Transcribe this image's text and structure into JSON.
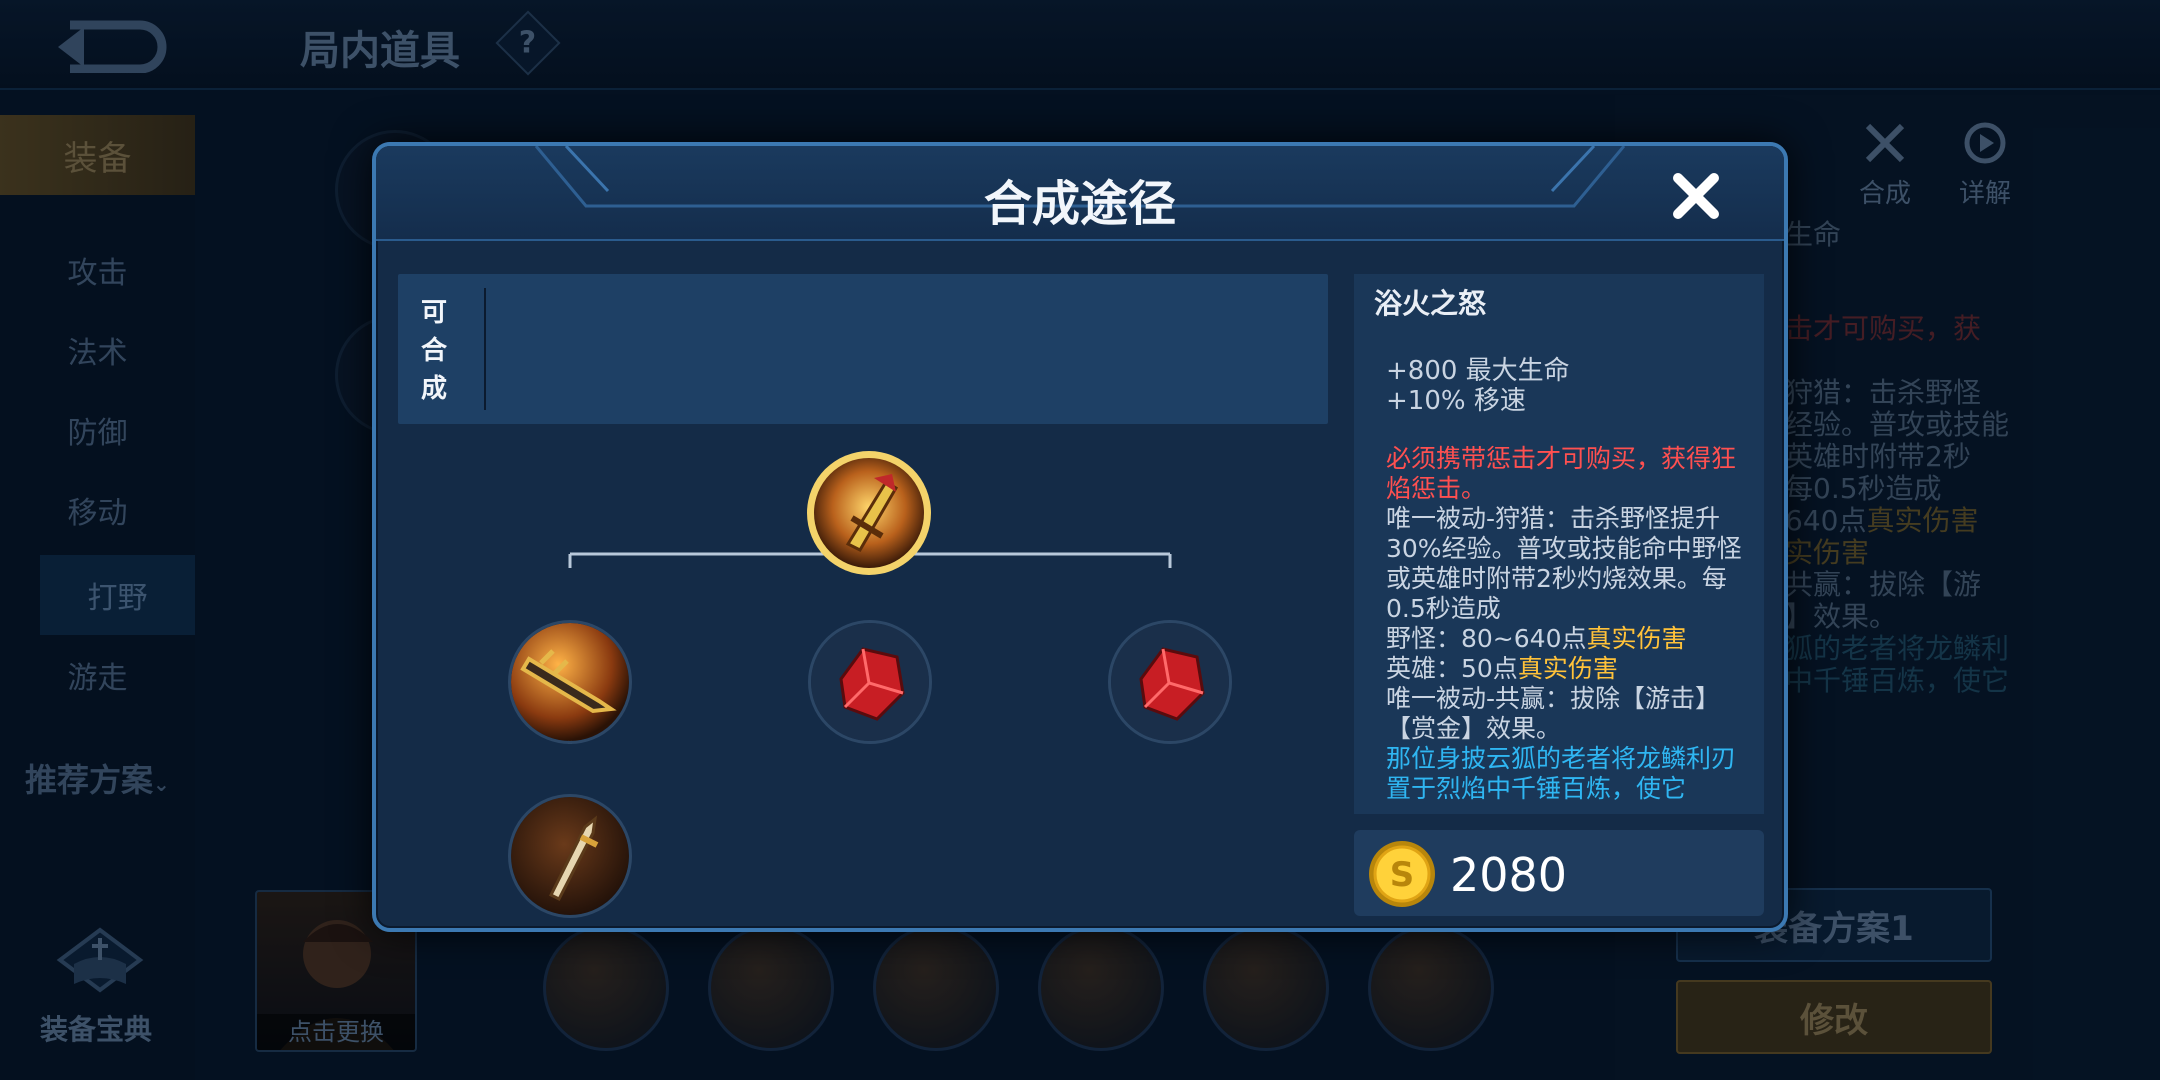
{
  "header": {
    "title": "局内道具",
    "help": "?"
  },
  "sidebar": {
    "items": [
      {
        "label": "装备"
      },
      {
        "label": "攻击"
      },
      {
        "label": "法术"
      },
      {
        "label": "防御"
      },
      {
        "label": "移动"
      },
      {
        "label": "打野"
      },
      {
        "label": "游走"
      }
    ],
    "recommend": "推荐方案",
    "codex": "装备宝典"
  },
  "hero": {
    "change_label": "点击更换"
  },
  "right_panel": {
    "blend": "合成",
    "detail": "详解",
    "plan_button": "装备方案1",
    "modify_button": "修改"
  },
  "modal": {
    "title": "合成途径",
    "craftable_label": "可合成",
    "item": {
      "name": "浴火之怒",
      "stats": [
        "+800 最大生命",
        "+10% 移速"
      ],
      "description": {
        "requirement": "必须携带惩击才可购买，获得狂焰惩击。",
        "passive1_a": "唯一被动-狩猎：击杀野怪提升30%经验。普攻或技能命中野怪或英雄时附带2秒灼烧效果。每0.5秒造成",
        "monster_prefix": "野怪：80~640点",
        "true_damage": "真实伤害",
        "hero_prefix": "英雄：50点",
        "passive2": "唯一被动-共赢：拔除【游击】【赏金】效果。",
        "lore": "那位身披云狐的老者将龙鳞利刃置于烈焰中千锤百炼，使它"
      },
      "price": "2080"
    }
  },
  "colors": {
    "accent": "#3c79b2",
    "gold": "#ffc23a",
    "red": "#ff5050",
    "cyan": "#2fb6f2"
  }
}
